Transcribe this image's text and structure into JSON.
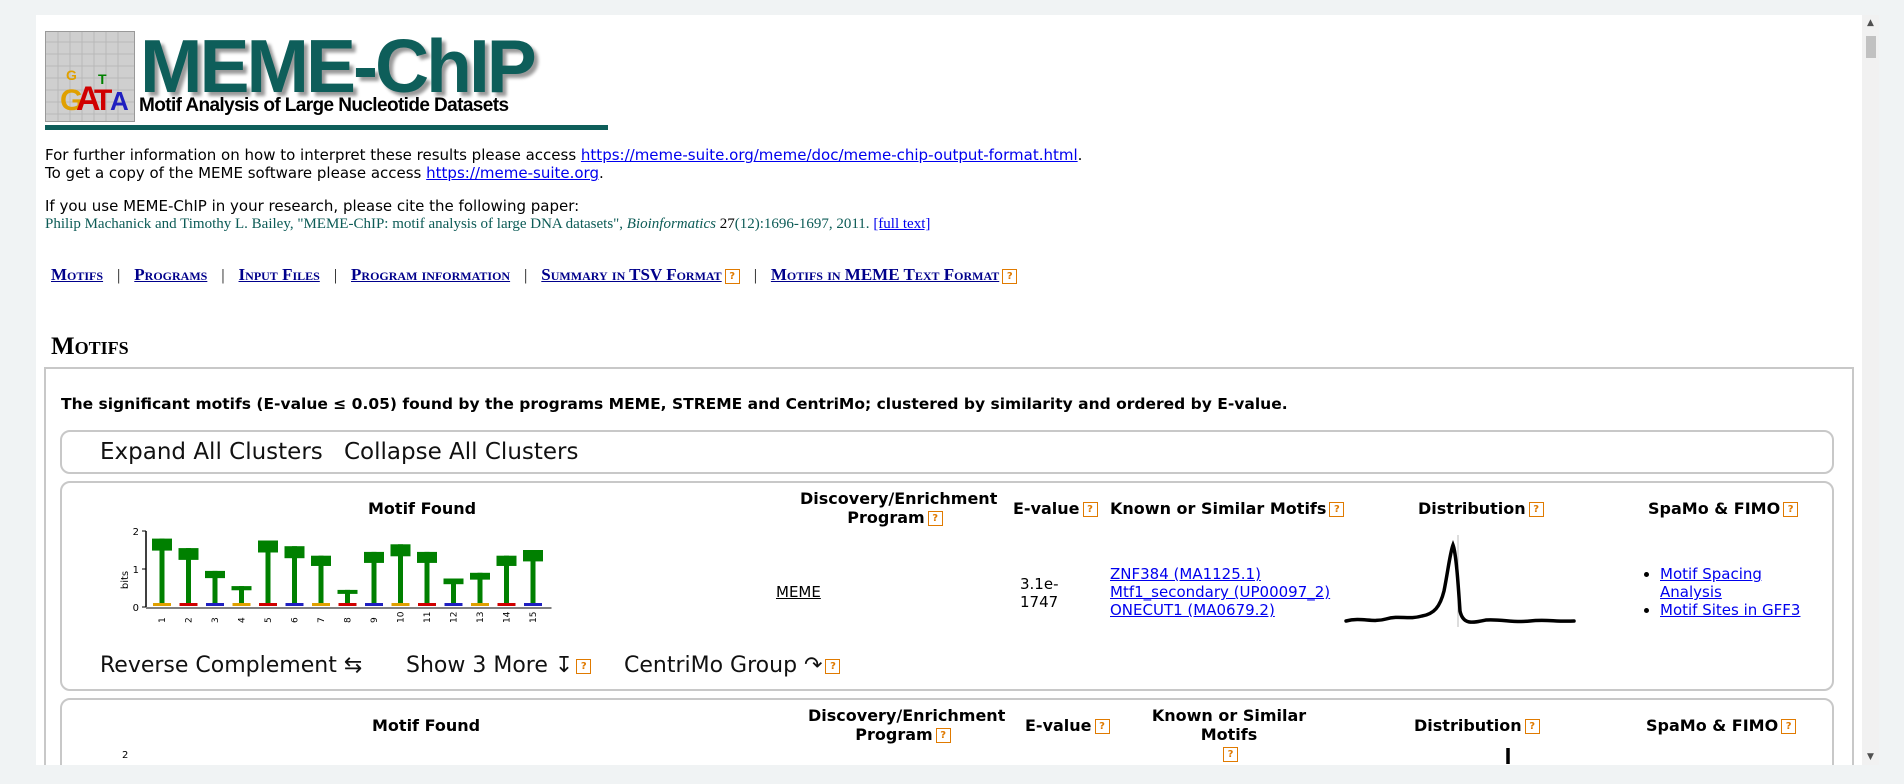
{
  "header": {
    "title": "MEME-ChIP",
    "subtitle": "Motif Analysis of Large Nucleotide Datasets"
  },
  "info": {
    "line1_text": "For further information on how to interpret these results please access ",
    "line1_link": "https://meme-suite.org/meme/doc/meme-chip-output-format.html",
    "line1_end": ".",
    "line2_text": "To get a copy of the MEME software please access ",
    "line2_link": "https://meme-suite.org",
    "line2_end": ".",
    "cite_intro": "If you use MEME-ChIP in your research, please cite the following paper:",
    "cite_authors": "Philip Machanick and Timothy L. Bailey, \"MEME-ChIP: motif analysis of large DNA datasets\", ",
    "cite_journal": "Bioinformatics",
    "cite_volume": "27",
    "cite_rest": "(12):1696-1697, 2011. ",
    "cite_link": "[full text]"
  },
  "nav": {
    "motifs": "Motifs",
    "programs": "Programs",
    "input_files": "Input Files",
    "program_info": "Program information",
    "summary_tsv": "Summary in TSV Format",
    "motifs_meme": "Motifs in MEME Text Format",
    "separator": "|"
  },
  "motifs_section": {
    "heading": "Motifs",
    "description": "The significant motifs (E-value ≤ 0.05) found by the programs MEME, STREME and CentriMo; clustered by similarity and ordered by E-value.",
    "expand_all": "Expand All Clusters",
    "collapse_all": "Collapse All Clusters"
  },
  "table_headers": {
    "motif_found": "Motif Found",
    "program_line1": "Discovery/Enrichment",
    "program_line2": "Program",
    "evalue": "E-value",
    "known": "Known or Similar Motifs",
    "distribution": "Distribution",
    "spamo": "SpaMo & FIMO"
  },
  "help_glyph": "?",
  "cluster1": {
    "program": "MEME",
    "evalue_line1": "3.1e-",
    "evalue_line2": "1747",
    "known_motifs": [
      "ZNF384 (MA1125.1)",
      "Mtf1_secondary (UP00097_2)",
      "ONECUT1 (MA0679.2)"
    ],
    "links": [
      "Motif Spacing",
      "Analysis",
      "Motif Sites in GFF3"
    ],
    "reverse_complement": "Reverse Complement ⇆",
    "show_more": "Show 3 More ↧",
    "centrimo_group": "CentriMo Group ↷",
    "logo": {
      "y_axis_label": "bits",
      "y_ticks": [
        "0",
        "1",
        "2"
      ],
      "positions": [
        "1",
        "2",
        "3",
        "4",
        "5",
        "6",
        "7",
        "8",
        "9",
        "10",
        "11",
        "12",
        "13",
        "14",
        "15"
      ],
      "t_heights_bits": [
        1.8,
        1.55,
        0.95,
        0.55,
        1.75,
        1.6,
        1.35,
        0.45,
        1.45,
        1.65,
        1.45,
        0.75,
        0.9,
        1.35,
        1.5
      ]
    }
  },
  "cluster2": {
    "logo_y_tick_top": "2"
  },
  "colors": {
    "title_teal": "#0e5e5a",
    "link_blue": "#0000ee",
    "help_orange": "#e07a00",
    "logo_T_green": "#008000"
  }
}
